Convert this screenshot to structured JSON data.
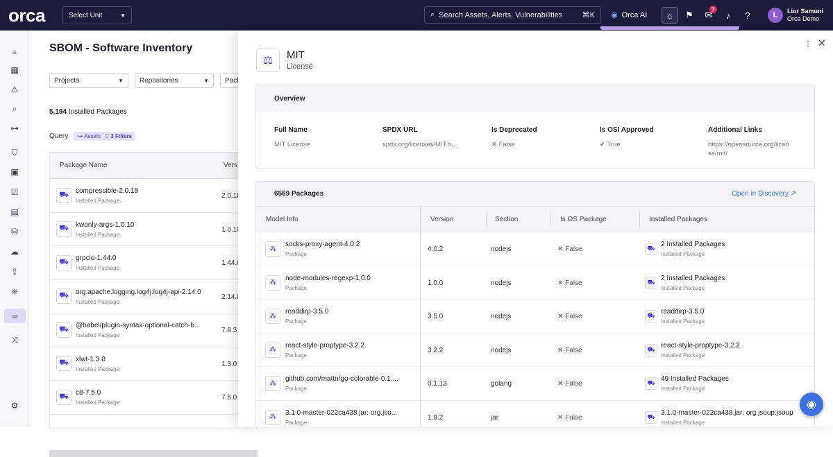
{
  "topbar": {
    "logo": "orca",
    "unit_label": "Select Unit",
    "search_placeholder": "Search Assets, Alerts, Vulnerabilities",
    "search_shortcut": "⌘K",
    "orca_ai": "Orca AI",
    "chat_badge": "3",
    "user_name": "Lior Samuni",
    "user_org": "Orca Demo",
    "avatar_initial": "L"
  },
  "page": {
    "title": "SBOM - Software Inventory",
    "filters": [
      "Projects",
      "Repositories",
      "Pack"
    ],
    "count_number": "5,194",
    "count_label": "Installed Packages",
    "query_label": "Query",
    "query_chip_assets": "Assets",
    "query_chip_filters": "3 Filters"
  },
  "left_table": {
    "col_name": "Package Name",
    "col_version": "Vers",
    "rows": [
      {
        "name": "compressible-2.0.18",
        "sub": "Installed Package",
        "version": "2.0.18"
      },
      {
        "name": "kwonly-args-1.0.10",
        "sub": "Installed Package",
        "version": "1.0.10"
      },
      {
        "name": "grpcio-1.44.0",
        "sub": "Installed Package",
        "version": "1.44.0"
      },
      {
        "name": "org.apache.logging.log4j:log4j-api-2.14.0",
        "sub": "Installed Package",
        "version": "2.14.0"
      },
      {
        "name": "@babel/plugin-syntax-optional-catch-b...",
        "sub": "Installed Package",
        "version": "7.8.3"
      },
      {
        "name": "xlwt-1.3.0",
        "sub": "Installed Package",
        "version": "1.3.0"
      },
      {
        "name": "c8-7.5.0",
        "sub": "Installed Package",
        "version": "7.5.0"
      }
    ]
  },
  "panel": {
    "title": "MIT",
    "subtitle": "License",
    "overview_title": "Overview",
    "fields": [
      {
        "label": "Full Name",
        "value": "MIT License"
      },
      {
        "label": "SPDX URL",
        "value": "spdx.org/licenses/MIT.h..."
      },
      {
        "label": "Is Deprecated",
        "value": "✕ False"
      },
      {
        "label": "Is OSI Approved",
        "value": "✔ True"
      },
      {
        "label": "Additional Links",
        "value": "https://opensource.org/licen se/mit/"
      }
    ],
    "packages_title": "6569 Packages",
    "discovery_link": "Open in Discovery ↗",
    "columns": [
      "Model Info",
      "Version",
      "Section",
      "Is OS Package",
      "Installed Packages"
    ],
    "rows": [
      {
        "name": "socks-proxy-agent-4.0.2",
        "sub": "Package",
        "version": "4.0.2",
        "section": "nodejs",
        "is_os": "✕ False",
        "installed": "2 Installed Packages",
        "installed_sub": "Installed Package"
      },
      {
        "name": "node-modules-regexp-1.0.0",
        "sub": "Package",
        "version": "1.0.0",
        "section": "nodejs",
        "is_os": "✕ False",
        "installed": "2 Installed Packages",
        "installed_sub": "Installed Package"
      },
      {
        "name": "readdirp-3.5.0",
        "sub": "Package",
        "version": "3.5.0",
        "section": "nodejs",
        "is_os": "✕ False",
        "installed": "readdirp-3.5.0",
        "installed_sub": "Installed Package"
      },
      {
        "name": "react-style-proptype-3.2.2",
        "sub": "Package",
        "version": "3.2.2",
        "section": "nodejs",
        "is_os": "✕ False",
        "installed": "react-style-proptype-3.2.2",
        "installed_sub": "Installed Package"
      },
      {
        "name": "github.com/mattn/go-colorable-0.1....",
        "sub": "Package",
        "version": "0.1.13",
        "section": "golang",
        "is_os": "✕ False",
        "installed": "49 Installed Packages",
        "installed_sub": "Installed Package"
      },
      {
        "name": "3.1.0-master-022ca438.jar: org.jso...",
        "sub": "Package",
        "version": "1.9.2",
        "section": "jar",
        "is_os": "✕ False",
        "installed": "3.1.0-master-022ca438.jar: org.jsoup:jsoup",
        "installed_sub": "Installed Package"
      }
    ]
  },
  "colors": {
    "topbar": "#1b1b3a",
    "accent": "#4b3ed3",
    "link": "#3d7be0"
  }
}
